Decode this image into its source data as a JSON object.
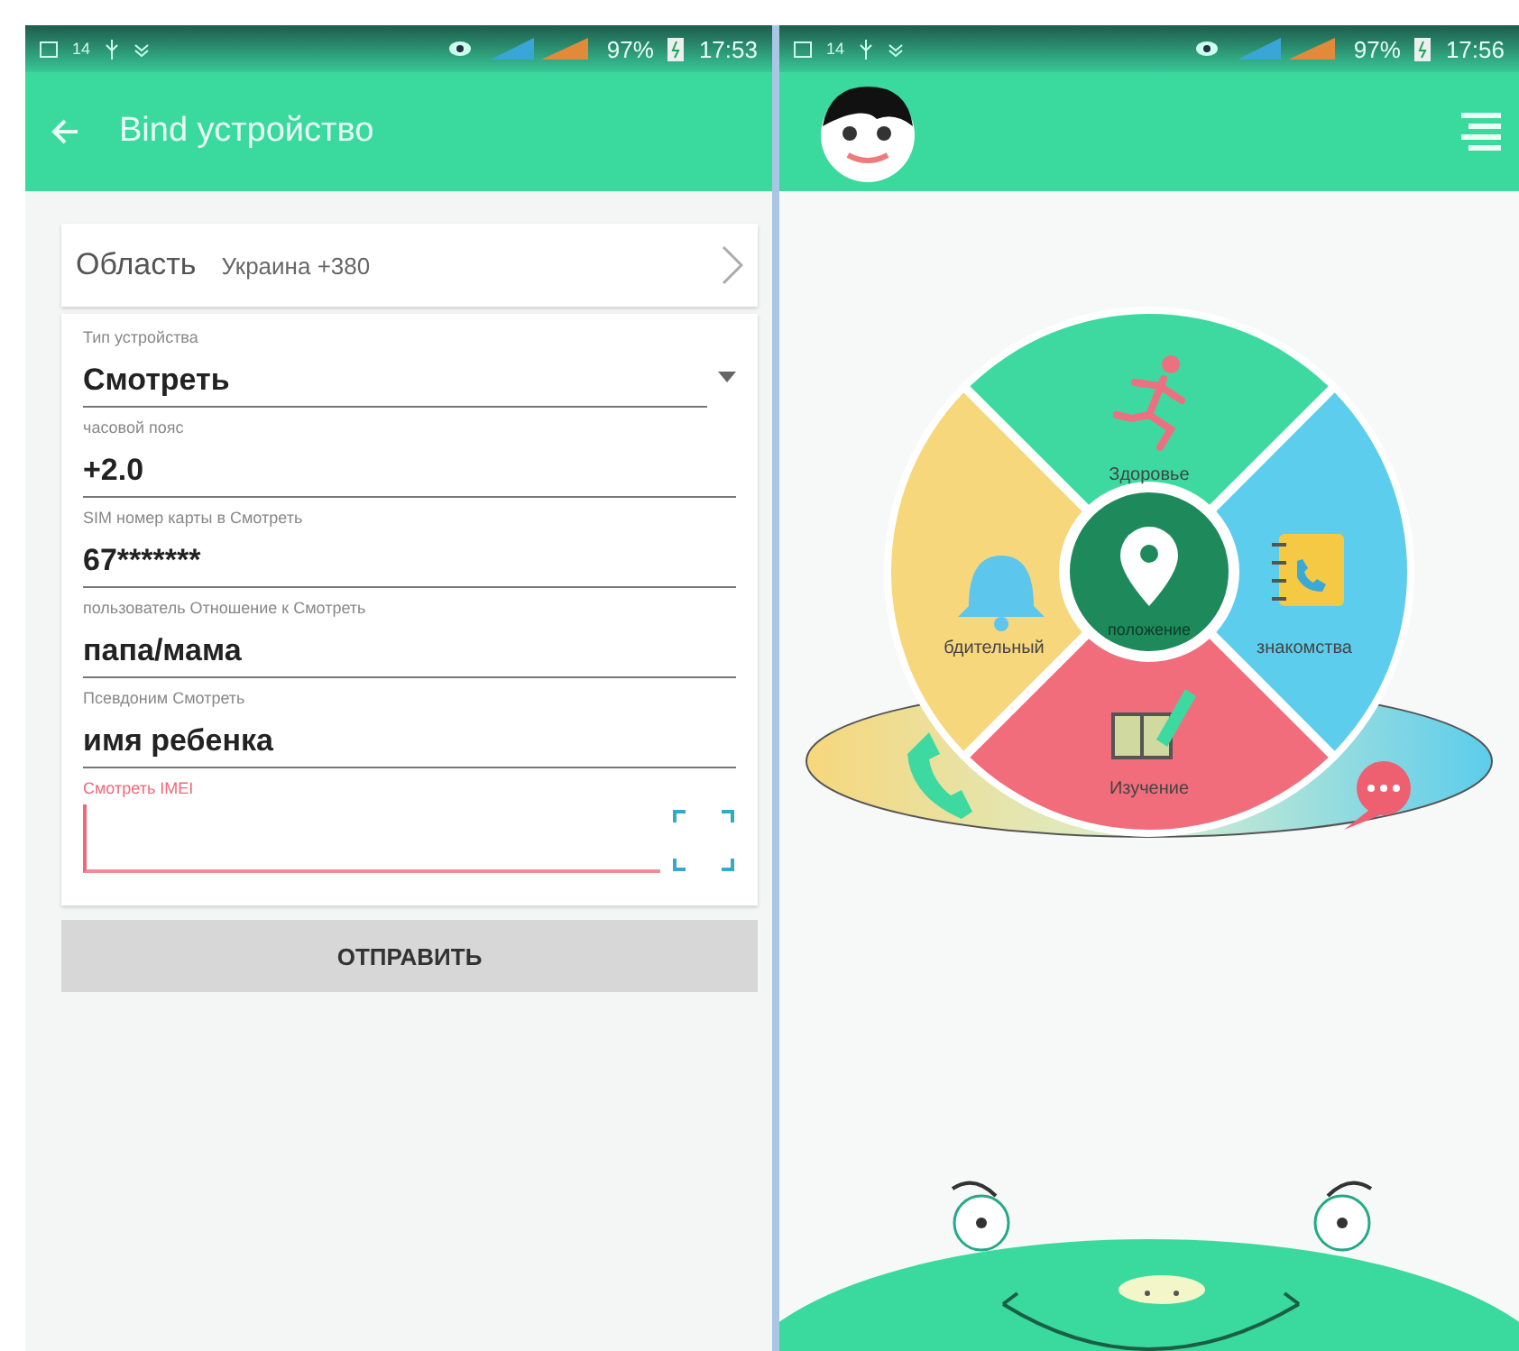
{
  "left_screen": {
    "status_bar": {
      "notification_count": "14",
      "battery": "97%",
      "time": "17:53"
    },
    "app_bar": {
      "title": "Bind устройство"
    },
    "region": {
      "label": "Область",
      "value": "Украина +380"
    },
    "fields": [
      {
        "kind": "dropdown",
        "label": "Тип устройства",
        "value": "Смотреть",
        "focused": false
      },
      {
        "kind": "text",
        "label": "часовой пояс",
        "value": "+2.0",
        "focused": false
      },
      {
        "kind": "text",
        "label": "SIM номер карты в Смотреть",
        "value": "67*******",
        "focused": false
      },
      {
        "kind": "text",
        "label": "пользователь Отношение к Смотреть",
        "value": "папа/мама",
        "focused": false
      },
      {
        "kind": "text",
        "label": "Псевдоним Смотреть",
        "value": "имя ребенка",
        "focused": false
      },
      {
        "kind": "scan",
        "label": "Смотреть IMEI",
        "focused": true
      }
    ],
    "submit": "ОТПРАВИТЬ"
  },
  "right_screen": {
    "status_bar": {
      "notification_count": "14",
      "battery": "97%",
      "time": "17:56"
    },
    "wheel": {
      "center": "положение",
      "sectors": [
        {
          "label": "Здоровье",
          "color": "#3ed9a0"
        },
        {
          "label": "знакомства",
          "color": "#5ccdec"
        },
        {
          "label": "Изучение",
          "color": "#f26d7c"
        },
        {
          "label": "бдительный",
          "color": "#f6d77c"
        }
      ]
    }
  }
}
